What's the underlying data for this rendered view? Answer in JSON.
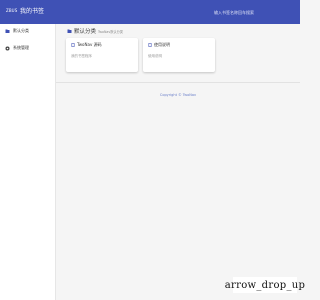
{
  "header": {
    "brand_small": "ZBUS",
    "title": "我的书签",
    "search_placeholder": "输入书签名称回车搜索"
  },
  "sidebar": {
    "items": [
      {
        "label": "默认分类",
        "icon": "bookmark-icon"
      },
      {
        "label": "系统管理",
        "icon": "gear-icon"
      }
    ]
  },
  "main": {
    "section": {
      "title": "默认分类",
      "subtitle": "TwoNav默认分类",
      "icon": "bookmark-icon"
    },
    "cards": [
      {
        "title": "TwoNav 源码",
        "description": "我的书签程序",
        "icon": "file-icon"
      },
      {
        "title": "使用说明",
        "description": "使用说明",
        "icon": "file-icon"
      }
    ],
    "footer": "Copyright © TwoNav"
  },
  "floating": {
    "label": "arrow_drop_up"
  },
  "colors": {
    "header_bg": "#3f51b5",
    "footer_link": "#6a7fc9"
  }
}
